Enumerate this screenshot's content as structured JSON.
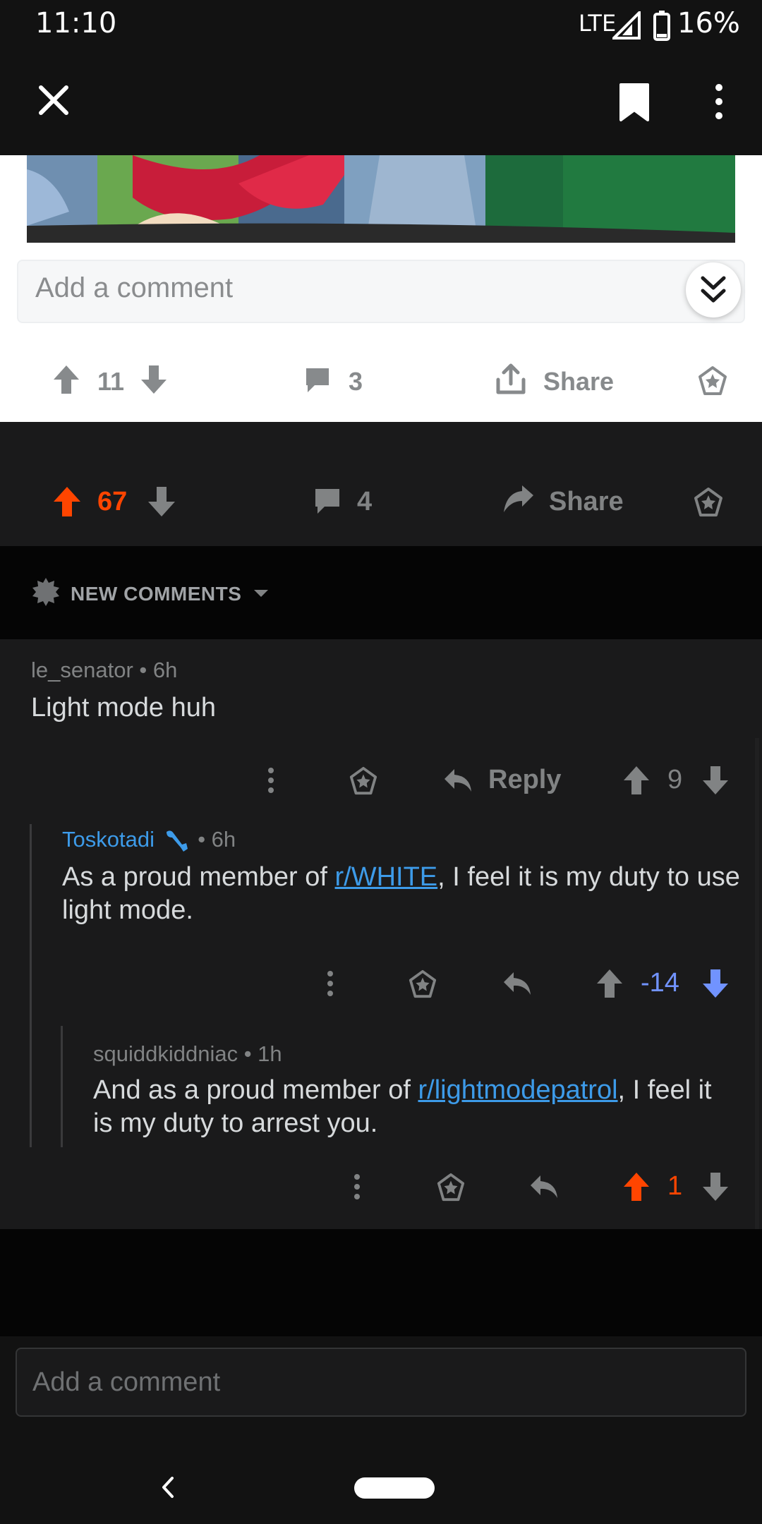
{
  "status_bar": {
    "time": "11:10",
    "network": "LTE",
    "battery": "16%"
  },
  "light_card": {
    "comment_placeholder": "Add a comment",
    "votes": "11",
    "comments": "3",
    "share_label": "Share"
  },
  "post_actions": {
    "votes": "67",
    "comments": "4",
    "share_label": "Share"
  },
  "sort": {
    "label": "NEW COMMENTS"
  },
  "comments": [
    {
      "author": "le_senator",
      "time": "• 6h",
      "body": "Light mode huh",
      "reply_label": "Reply",
      "score": "9"
    },
    {
      "author": "Toskotadi",
      "time": "• 6h",
      "body_prefix": "As a proud member of ",
      "body_link": "r/WHITE",
      "body_suffix": ", I feel it is my duty to use light mode.",
      "score": "-14"
    },
    {
      "author": "squiddkiddniac",
      "time": "• 1h",
      "body_prefix": "And as a proud member of ",
      "body_link": "r/lightmodepatrol",
      "body_suffix": ", I feel it is my duty to arrest you.",
      "score": "1"
    }
  ],
  "bottom_input": {
    "placeholder": "Add a comment"
  },
  "colors": {
    "upvote": "#ff4500",
    "downvote": "#7193ff",
    "link": "#3d9be9",
    "mod_badge": "#3d9be9"
  }
}
